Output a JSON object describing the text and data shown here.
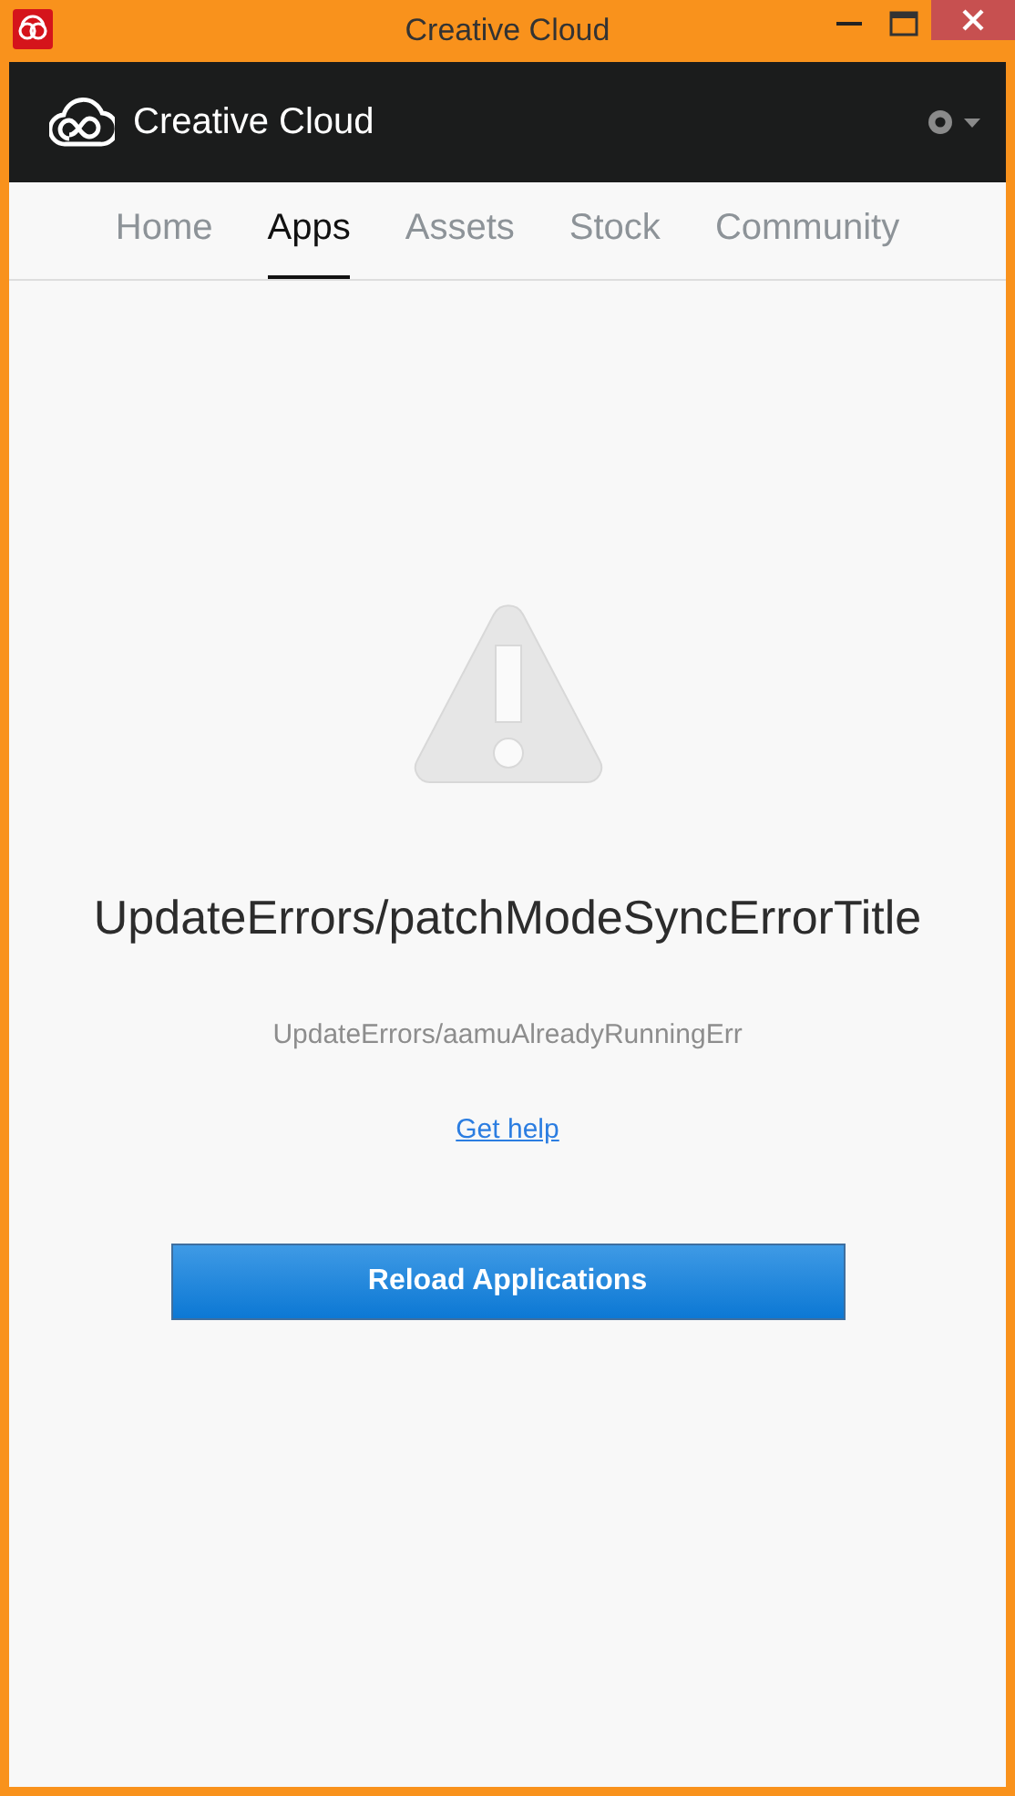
{
  "window": {
    "title": "Creative Cloud"
  },
  "header": {
    "title": "Creative Cloud"
  },
  "tabs": [
    {
      "label": "Home",
      "selected": false
    },
    {
      "label": "Apps",
      "selected": true
    },
    {
      "label": "Assets",
      "selected": false
    },
    {
      "label": "Stock",
      "selected": false
    },
    {
      "label": "Community",
      "selected": false
    }
  ],
  "error": {
    "title": "UpdateErrors/patchModeSyncErrorTitle",
    "message": "UpdateErrors/aamuAlreadyRunningErr",
    "link": "Get help",
    "button": "Reload Applications"
  }
}
